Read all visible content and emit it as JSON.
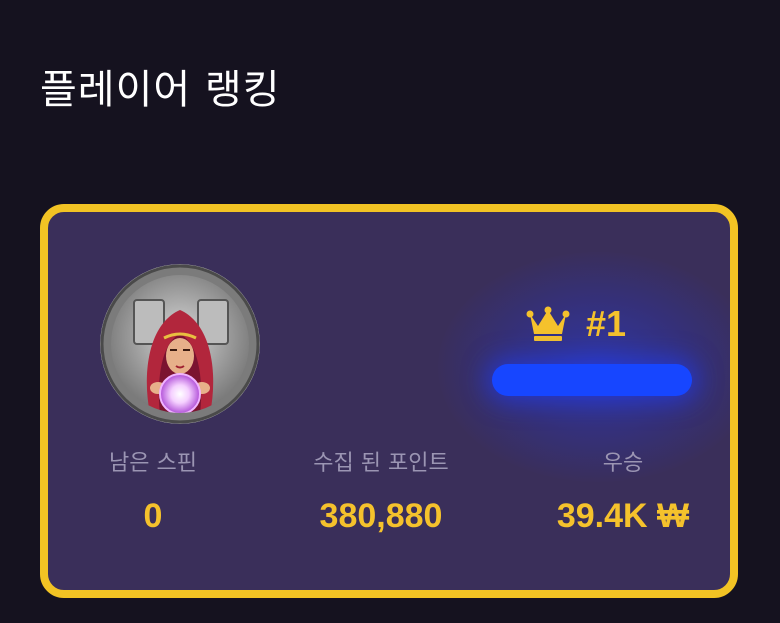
{
  "page": {
    "title": "플레이어 랭킹"
  },
  "player": {
    "avatar_icon": "fortune-teller-avatar-icon",
    "rank_icon": "crown-icon",
    "rank": "#1",
    "name_bar_color": "#1746ff"
  },
  "stats": {
    "spins_left": {
      "label": "남은 스핀",
      "value": "0"
    },
    "points": {
      "label": "수집 된 포인트",
      "value": "380,880"
    },
    "wins": {
      "label": "우승",
      "value": "39.4K ₩"
    }
  },
  "colors": {
    "background": "#15121f",
    "card": "#3a2f5a",
    "card_border": "#f2c324",
    "accent": "#f5c22c",
    "label": "#9b95b3"
  }
}
